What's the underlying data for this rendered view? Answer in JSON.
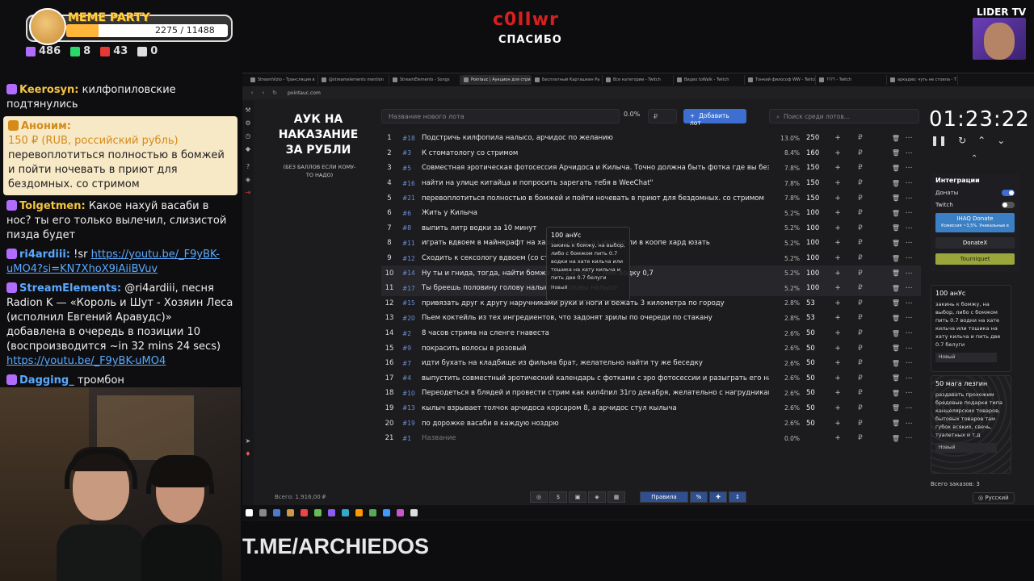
{
  "overlay": {
    "meme_party": {
      "title": "MEME PARTY",
      "count": "2275 / 11488",
      "progress": 0.198
    },
    "stats": [
      {
        "value": "486",
        "color": "#b26bff"
      },
      {
        "value": "8",
        "color": "#2bd96b"
      },
      {
        "value": "43",
        "color": "#e53935"
      },
      {
        "value": "0",
        "color": "#dddddd"
      }
    ],
    "brand": {
      "logo": "c0IIwr",
      "subtitle": "СПАСИБО"
    },
    "lider": {
      "label": "LIDER TV"
    },
    "footer_link": "T.ME/ARCHIEDOS"
  },
  "chat": [
    {
      "user": "Keerosyn:",
      "user_color": "#f5c542",
      "text": "килфопиловские подтянулись"
    },
    {
      "user": "Аноним:",
      "donation": true,
      "amount": "150 ₽ (RUB, российский рубль)",
      "text": "перевоплотиться полностью в бомжей и пойти ночевать в приют для бездомных. со стримом"
    },
    {
      "user": "Tolgetmen:",
      "user_color": "#f5c542",
      "text": "Какое нахуй васаби в нос? ты его только вылечил, слизистой пизда будет"
    },
    {
      "user": "ri4ardiii:",
      "user_color": "#5aa9ff",
      "text": "!sr",
      "link": "https://youtu.be/_F9yBK-uMO4?si=KN7XhoX9iAiiBVuv"
    },
    {
      "user": "StreamElements:",
      "user_color": "#5aa9ff",
      "text": "@ri4ardiii, песня Radion K — «Король и Шут - Хозяин Леса (исполнил Евгений Аравудс)» добавлена в очередь в позиции 10 (воспроизводится ~in 32 mins 24 secs)",
      "link": "https://youtu.be/_F9yBK-uMO4"
    },
    {
      "user": "Dagging_",
      "user_color": "#5aa9ff",
      "text": "тромбон"
    }
  ],
  "browser": {
    "tabs": [
      "StreamVizio - Трансляция в",
      "@streamelements mention",
      "StreamElements - Songs",
      "Pointauc | Аукцион для стри",
      "Бесплатный Карташкин Ра",
      "Все категории - Twitch",
      "Видео toWalk - Twitch",
      "Тонкий философ WW - Twitch",
      "???? - Twitch",
      "аркадио: чуть не стоила - T"
    ],
    "active_tab": 3,
    "url": "pointauc.com"
  },
  "auction": {
    "title": "АУК НА НАКАЗАНИЕ ЗА РУБЛИ",
    "subtitle": "(БЕЗ БАЛЛОВ ЕСЛИ КОМУ-ТО НАДО)",
    "new_lot_placeholder": "Название нового лота",
    "pct": "0.0%",
    "rub": "₽",
    "add_button": "Добавить лот",
    "search_placeholder": "Поиск среди лотов...",
    "lots": [
      {
        "n": "1",
        "id": "#18",
        "name": "Подстричь килфопила налысо, арчидос по желанию",
        "pct": "13.0%",
        "val": "250"
      },
      {
        "n": "2",
        "id": "#3",
        "name": "К стоматологу со стримом",
        "pct": "8.4%",
        "val": "160"
      },
      {
        "n": "3",
        "id": "#5",
        "name": "Совместная эротическая фотосессия Арчидоса и Килыча. Точно должна быть фотка где вы без футб",
        "pct": "7.8%",
        "val": "150"
      },
      {
        "n": "4",
        "id": "#16",
        "name": "найти на улице китайца и попросить зарегать тебя в WeeChat\"",
        "pct": "7.8%",
        "val": "150"
      },
      {
        "n": "5",
        "id": "#21",
        "name": "перевоплотиться полностью в бомжей и пойти ночевать в приют для бездомных. со стримом",
        "pct": "7.8%",
        "val": "150"
      },
      {
        "n": "6",
        "id": "#6",
        "name": "Жить у Килыча",
        "pct": "5.2%",
        "val": "100"
      },
      {
        "n": "7",
        "id": "#8",
        "name": "выпить литр водки за 10 минут",
        "pct": "5.2%",
        "val": "100"
      },
      {
        "n": "8",
        "id": "#11",
        "name": "играть вдвоем в майнкрафт на хард                                    дракона, хз можно ли в коопе хард юзать",
        "pct": "5.2%",
        "val": "100"
      },
      {
        "n": "9",
        "id": "#12",
        "name": "Сходить к сексологу вдвоем (со ст",
        "pct": "5.2%",
        "val": "100"
      },
      {
        "n": "10",
        "id": "#14",
        "name": "Ну ты и гнида, тогда, найти бомжа                                     атха и пить с ним водку 0,7",
        "pct": "5.2%",
        "val": "100",
        "hl": true
      },
      {
        "n": "11",
        "id": "#17",
        "name": "Ты бреешь половину голову налысо                                    ы головы налысо",
        "pct": "5.2%",
        "val": "100",
        "hl": true
      },
      {
        "n": "12",
        "id": "#15",
        "name": "привязать друг к другу наручниками руки и ноги и бежать 3 километра по городу",
        "pct": "2.8%",
        "val": "53"
      },
      {
        "n": "13",
        "id": "#20",
        "name": "Пьем коктейль из тех ингредиентов, что задонят зрилы по очереди по стакану",
        "pct": "2.8%",
        "val": "53"
      },
      {
        "n": "14",
        "id": "#2",
        "name": "8 часов стрима на сленге гнавеста",
        "pct": "2.6%",
        "val": "50"
      },
      {
        "n": "15",
        "id": "#9",
        "name": "покрасить волосы в розовый",
        "pct": "2.6%",
        "val": "50"
      },
      {
        "n": "16",
        "id": "#7",
        "name": "идти бухать на кладбище из фильма брат, желательно найти ту же беседку",
        "pct": "2.6%",
        "val": "50"
      },
      {
        "n": "17",
        "id": "#4",
        "name": "выпустить совместный эротический календарь с фотками с эро фотосессии и разыграть его на ауке",
        "pct": "2.6%",
        "val": "50"
      },
      {
        "n": "18",
        "id": "#10",
        "name": "Переодеться в блядей и провести стрим как кил4пил 31го декабря, желательно с нагрудниками",
        "pct": "2.6%",
        "val": "50"
      },
      {
        "n": "19",
        "id": "#13",
        "name": "кылыч взрывает толчок арчидоса корсаром 8, а арчидос стул кылыча",
        "pct": "2.6%",
        "val": "50"
      },
      {
        "n": "20",
        "id": "#19",
        "name": "по дорожке васаби в каждую ноздрю",
        "pct": "2.6%",
        "val": "50"
      },
      {
        "n": "21",
        "id": "#1",
        "name": "Название",
        "pct": "0.0%",
        "val": "",
        "placeholder": true
      }
    ],
    "popup": {
      "title": "100 анУс",
      "text": "закинь к бомжу, на выбор, либо с бомжом пить 0.7 водки на хате кильча или тошика на хату кильча и пить две 0.7 белуги",
      "tag": "Новый"
    },
    "total": "Всего: 1.916,00 ₽",
    "bottom_buttons": [
      "◎",
      "$",
      "▣",
      "◈",
      "▦",
      "Правила",
      "%",
      "✚",
      "↕"
    ]
  },
  "right_panel": {
    "timer": "01:23:22",
    "integrations": {
      "title": "Интеграции",
      "donations": "Донаты",
      "twitch": "Twitch",
      "ihaq": "IHAQ Donate",
      "ihaq_sub": "Комиссия ~3,5%. Уникальные в",
      "donatex": "DonateX",
      "tourniquet": "Tourniquet"
    },
    "card1": {
      "title": "100 анУс",
      "text": "закинь к бомжу, на выбор, либо с бомжом пить 0.7 водки на хате кильча или тошика на хату кильча и пить две 0.7 белуги",
      "tag": "Новый"
    },
    "card2": {
      "title": "50 мага лезгин",
      "text": "раздавать прохожим бредовые подарки типа канцелярских товаров, бытовых товаров там губок всяких, свечь, туалетных и т.д",
      "tag": "Новый"
    },
    "orders": "Всего заказов: 3",
    "lang": "Русский"
  }
}
